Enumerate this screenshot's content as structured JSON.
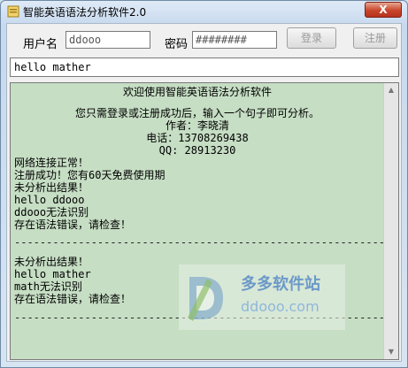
{
  "window": {
    "title": "智能英语语法分析软件2.0",
    "close_label": "X"
  },
  "login": {
    "username_label": "用户名",
    "username_value": "ddooo",
    "password_label": "密码",
    "password_value": "########",
    "login_button": "登录",
    "register_button": "注册"
  },
  "sentence_input": {
    "value": "hello mather"
  },
  "output": {
    "header_lines": [
      "欢迎使用智能英语语法分析软件",
      "您只需登录或注册成功后，输入一个句子即可分析。",
      "作者：李晓清",
      "电话：13708269438",
      "QQ: 28913230"
    ],
    "log_lines": [
      "网络连接正常！",
      "注册成功！您有60天免费使用期",
      "未分析出结果！",
      "hello ddooo",
      "ddooo无法识别",
      "存在语法错误，请检查！",
      "",
      "------------------------------------------------------------------",
      "",
      "未分析出结果！",
      "hello mather",
      "math无法识别",
      "存在语法错误，请检查！",
      "",
      "------------------------------------------------------------------"
    ]
  },
  "watermark": {
    "name_cn": "多多软件站",
    "domain": "ddooo.com"
  },
  "colors": {
    "output_bg": "#c6dec4",
    "close_button": "#c8452b",
    "watermark_blue": "#6c99c8"
  }
}
